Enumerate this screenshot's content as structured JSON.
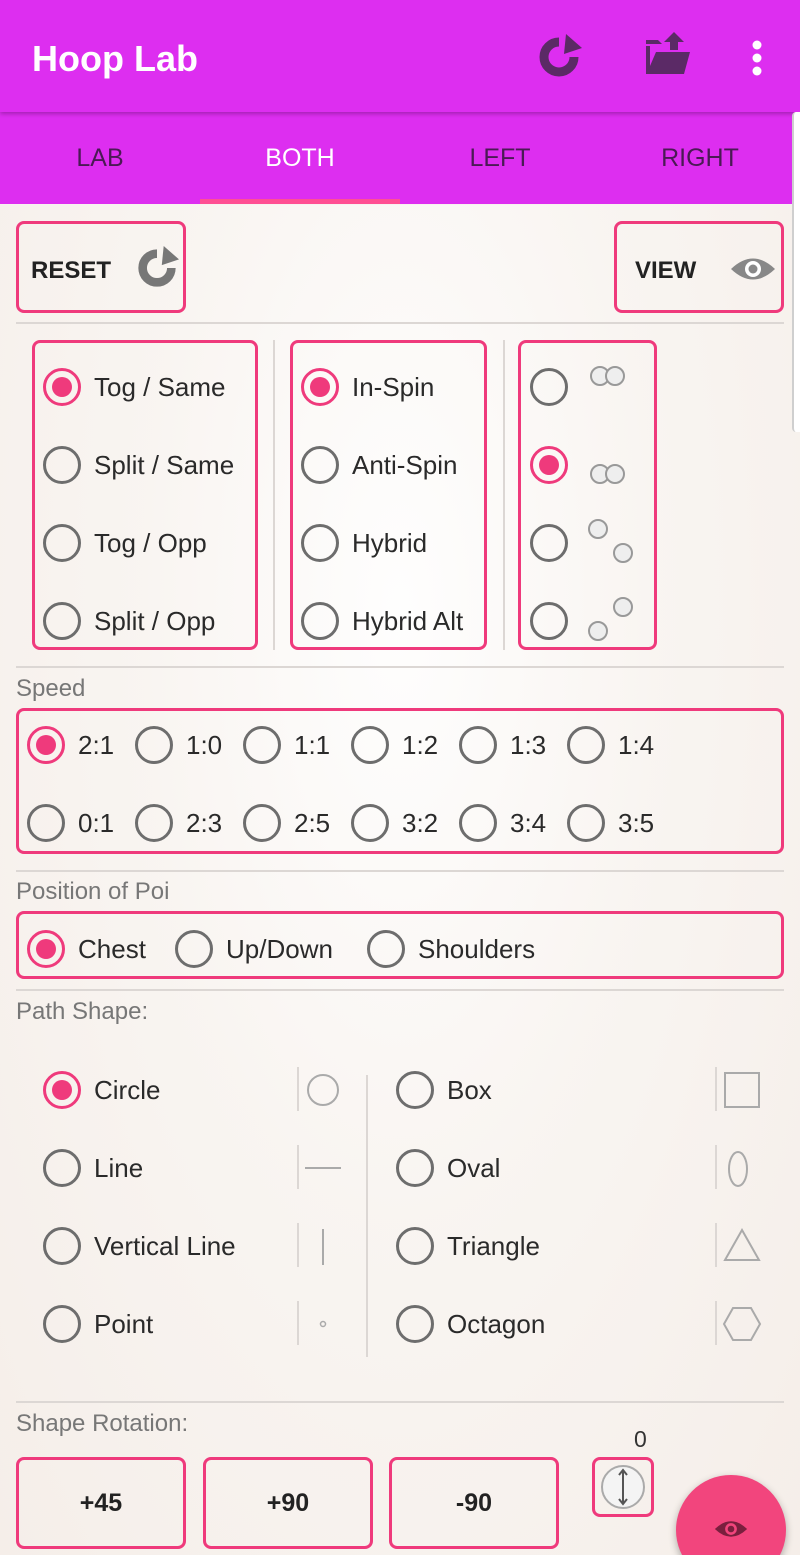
{
  "app": {
    "title": "Hoop Lab",
    "accent_color": "#dd2ef0",
    "highlight_color": "#ef3a7c"
  },
  "toolbar": {
    "icons": [
      "redo-icon",
      "share-folder-icon",
      "more-vert-icon"
    ]
  },
  "tabs": [
    {
      "label": "LAB",
      "active": false
    },
    {
      "label": "BOTH",
      "active": true
    },
    {
      "label": "LEFT",
      "active": false
    },
    {
      "label": "RIGHT",
      "active": false
    }
  ],
  "actions": {
    "reset_label": "RESET",
    "view_label": "VIEW"
  },
  "direction": {
    "options": [
      "Tog / Same",
      "Split / Same",
      "Tog / Opp",
      "Split / Opp"
    ],
    "selected": "Tog / Same"
  },
  "spin": {
    "options": [
      "In-Spin",
      "Anti-Spin",
      "Hybrid",
      "Hybrid Alt"
    ],
    "selected": "In-Spin"
  },
  "layout": {
    "options": [
      "overlap-top-icon",
      "overlap-bottom-icon",
      "diagonal-down-icon",
      "diagonal-up-icon"
    ],
    "selected_index": 1
  },
  "speed": {
    "title": "Speed",
    "options": [
      "2:1",
      "1:0",
      "1:1",
      "1:2",
      "1:3",
      "1:4",
      "0:1",
      "2:3",
      "2:5",
      "3:2",
      "3:4",
      "3:5"
    ],
    "selected": "2:1"
  },
  "position": {
    "title": "Position of Poi",
    "options": [
      "Chest",
      "Up/Down",
      "Shoulders"
    ],
    "selected": "Chest"
  },
  "path_shape": {
    "title": "Path Shape:",
    "left": [
      "Circle",
      "Line",
      "Vertical Line",
      "Point"
    ],
    "right": [
      "Box",
      "Oval",
      "Triangle",
      "Octagon"
    ],
    "selected": "Circle"
  },
  "rotation": {
    "title": "Shape Rotation:",
    "buttons": [
      "+45",
      "+90",
      "-90"
    ],
    "value": "0"
  }
}
